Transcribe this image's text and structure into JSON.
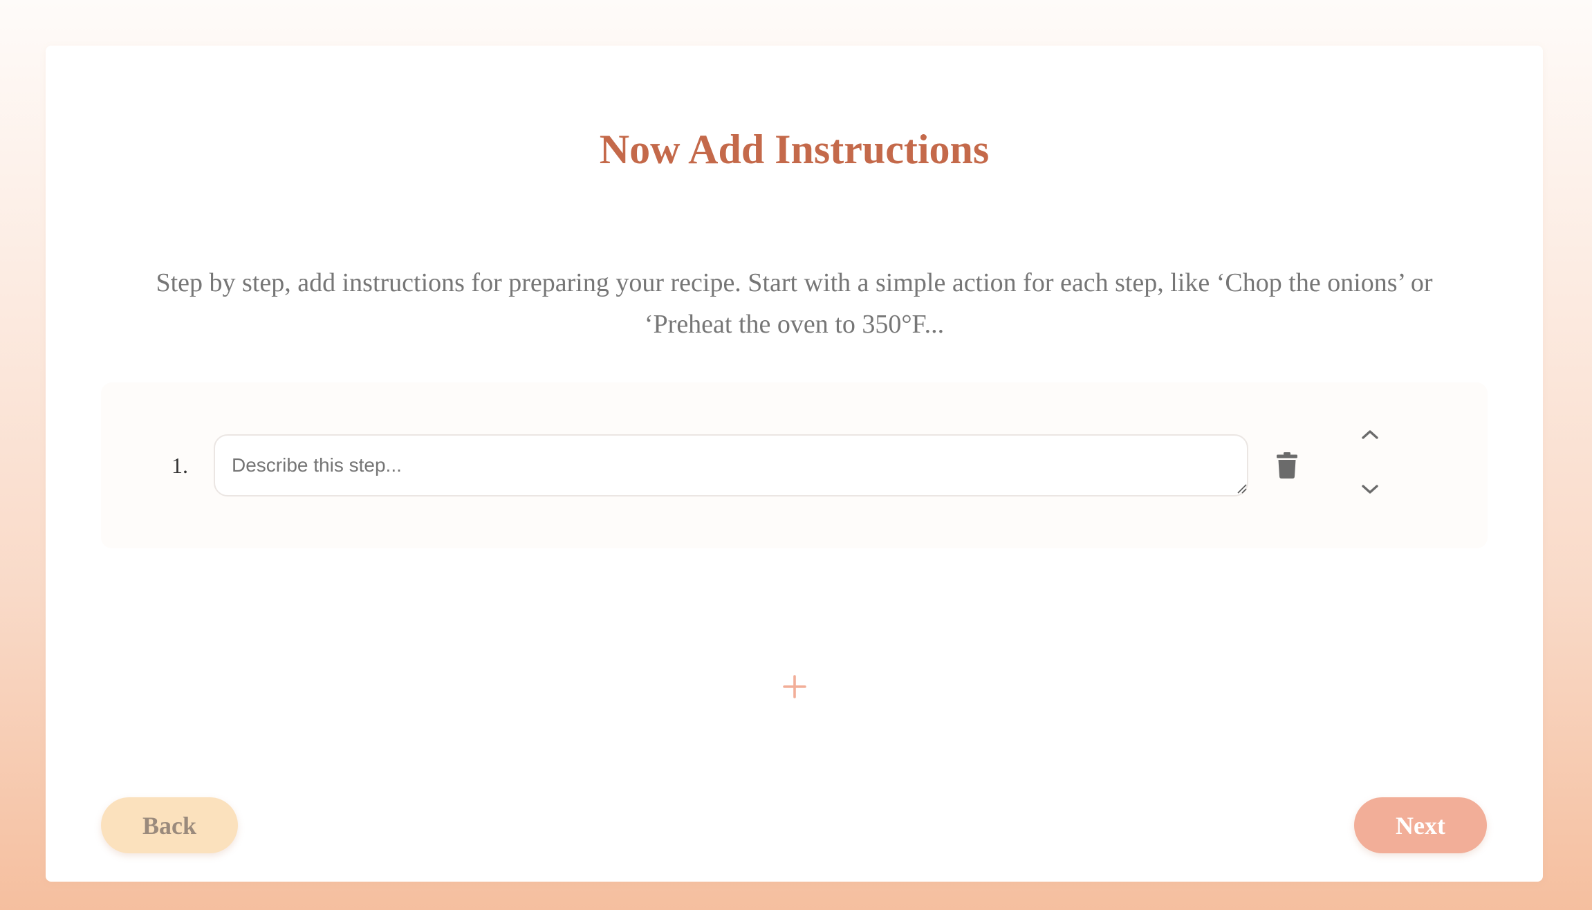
{
  "page": {
    "title": "Now Add Instructions",
    "description": "Step by step, add instructions for preparing your recipe. Start with a simple action for each step, like ‘Chop the onions’ or ‘Preheat the oven to 350°F..."
  },
  "steps": [
    {
      "number": "1.",
      "value": "",
      "placeholder": "Describe this step...",
      "icons": {
        "delete": "trash-icon",
        "move_up": "chevron-up-icon",
        "move_down": "chevron-down-icon"
      }
    }
  ],
  "add_step": {
    "icon": "plus-icon"
  },
  "navigation": {
    "back_label": "Back",
    "next_label": "Next"
  },
  "colors": {
    "title": "#c4694a",
    "accent": "#f2ae98",
    "back_button": "#fbe1bd",
    "icon": "#6b6b6b"
  }
}
